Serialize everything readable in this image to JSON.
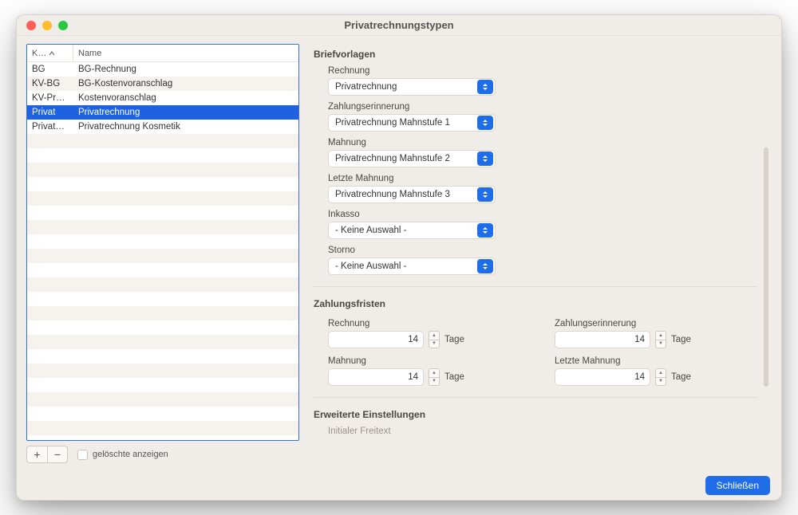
{
  "window": {
    "title": "Privatrechnungstypen"
  },
  "table": {
    "headers": {
      "k": "K…",
      "name": "Name"
    },
    "rows": [
      {
        "k": "BG",
        "name": "BG-Rechnung"
      },
      {
        "k": "KV-BG",
        "name": "BG-Kostenvoranschlag"
      },
      {
        "k": "KV-Pr…",
        "name": "Kostenvoranschlag"
      },
      {
        "k": "Privat",
        "name": "Privatrechnung"
      },
      {
        "k": "Privat…",
        "name": "Privatrechnung Kosmetik"
      }
    ],
    "selected_index": 3
  },
  "below_toolbar": {
    "add": "+",
    "remove": "−",
    "show_deleted_label": "gelöschte anzeigen"
  },
  "sections": {
    "templates_h": "Briefvorlagen",
    "deadlines_h": "Zahlungsfristen",
    "extended_h": "Erweiterte Einstellungen",
    "initial_cut": "Initialer Freitext"
  },
  "templates": {
    "rechnung": {
      "label": "Rechnung",
      "value": "Privatrechnung"
    },
    "erinnerung": {
      "label": "Zahlungserinnerung",
      "value": "Privatrechnung Mahnstufe 1"
    },
    "mahnung": {
      "label": "Mahnung",
      "value": "Privatrechnung Mahnstufe 2"
    },
    "letzte": {
      "label": "Letzte Mahnung",
      "value": "Privatrechnung Mahnstufe 3"
    },
    "inkasso": {
      "label": "Inkasso",
      "value": "- Keine Auswahl -"
    },
    "storno": {
      "label": "Storno",
      "value": "- Keine Auswahl -"
    }
  },
  "deadlines": {
    "unit": "Tage",
    "rechnung": {
      "label": "Rechnung",
      "value": "14"
    },
    "erinnerung": {
      "label": "Zahlungserinnerung",
      "value": "14"
    },
    "mahnung": {
      "label": "Mahnung",
      "value": "14"
    },
    "letzte": {
      "label": "Letzte Mahnung",
      "value": "14"
    }
  },
  "footer": {
    "close": "Schließen"
  }
}
